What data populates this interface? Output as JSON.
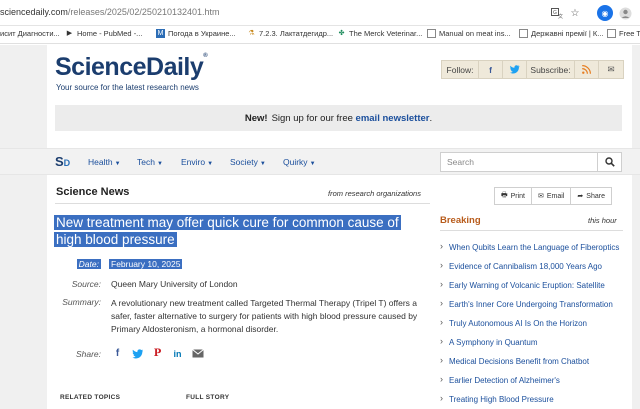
{
  "browser": {
    "url_host": "sciencedaily.com",
    "url_path": "/releases/2025/02/250210132401.htm",
    "bookmarks": [
      {
        "label": "исит Диагности...",
        "icon": "globe-icon"
      },
      {
        "label": "Home - PubMed -...",
        "icon": "pubmed-icon"
      },
      {
        "label": "Погода в Украине...",
        "icon": "weather-icon"
      },
      {
        "label": "7.2.3. Лактатдегидр...",
        "icon": "flask-icon"
      },
      {
        "label": "The Merck Veterinar...",
        "icon": "merck-icon"
      },
      {
        "label": "Manual on meat ins...",
        "icon": "document-icon"
      },
      {
        "label": "Державні премії | К...",
        "icon": "document-icon"
      },
      {
        "label": "Free T",
        "icon": "globe-icon"
      }
    ]
  },
  "header": {
    "logo_science": "Science",
    "logo_daily": "Daily",
    "tagline": "Your source for the latest research news",
    "follow_label": "Follow:",
    "subscribe_label": "Subscribe:"
  },
  "newsletter": {
    "new_label": "New!",
    "text_before": "Sign up for our free ",
    "link": "email newsletter",
    "text_after": "."
  },
  "nav": {
    "logo_s": "S",
    "logo_d": "D",
    "items": [
      "Health",
      "Tech",
      "Enviro",
      "Society",
      "Quirky"
    ],
    "search_placeholder": "Search"
  },
  "article": {
    "section": "Science News",
    "from": "from research organizations",
    "headline": "New treatment may offer quick cure for common cause of high blood pressure",
    "date_label": "Date:",
    "date": "February 10, 2025",
    "source_label": "Source:",
    "source": "Queen Mary University of London",
    "summary_label": "Summary:",
    "summary": "A revolutionary new treatment called Targeted Thermal Therapy (Tripel T) offers a safer, faster alternative to surgery for patients with high blood pressure caused by Primary Aldosteronism, a hormonal disorder.",
    "share_label": "Share:",
    "related_topics": "RELATED TOPICS",
    "full_story": "FULL STORY"
  },
  "sidebar": {
    "print": "Print",
    "email": "Email",
    "share": "Share",
    "breaking_title": "Breaking",
    "breaking_time": "this hour",
    "breaking": [
      "When Qubits Learn the Language of Fiberoptics",
      "Evidence of Cannibalism 18,000 Years Ago",
      "Early Warning of Volcanic Eruption: Satellite",
      "Earth's Inner Core Undergoing Transformation",
      "Truly Autonomous AI Is On the Horizon",
      "A Symphony in Quantum",
      "Medical Decisions Benefit from Chatbot",
      "Earlier Detection of Alzheimer's",
      "Treating High Blood Pressure"
    ]
  },
  "colors": {
    "brand_blue": "#1b3d6e",
    "link_blue": "#1b4f9c",
    "selection": "#3b6fc1",
    "breaking_orange": "#b85c1c",
    "facebook": "#3b5998",
    "twitter": "#1da1f2",
    "pinterest": "#cb2027",
    "linkedin": "#0077b5",
    "rss": "#e67e22"
  }
}
